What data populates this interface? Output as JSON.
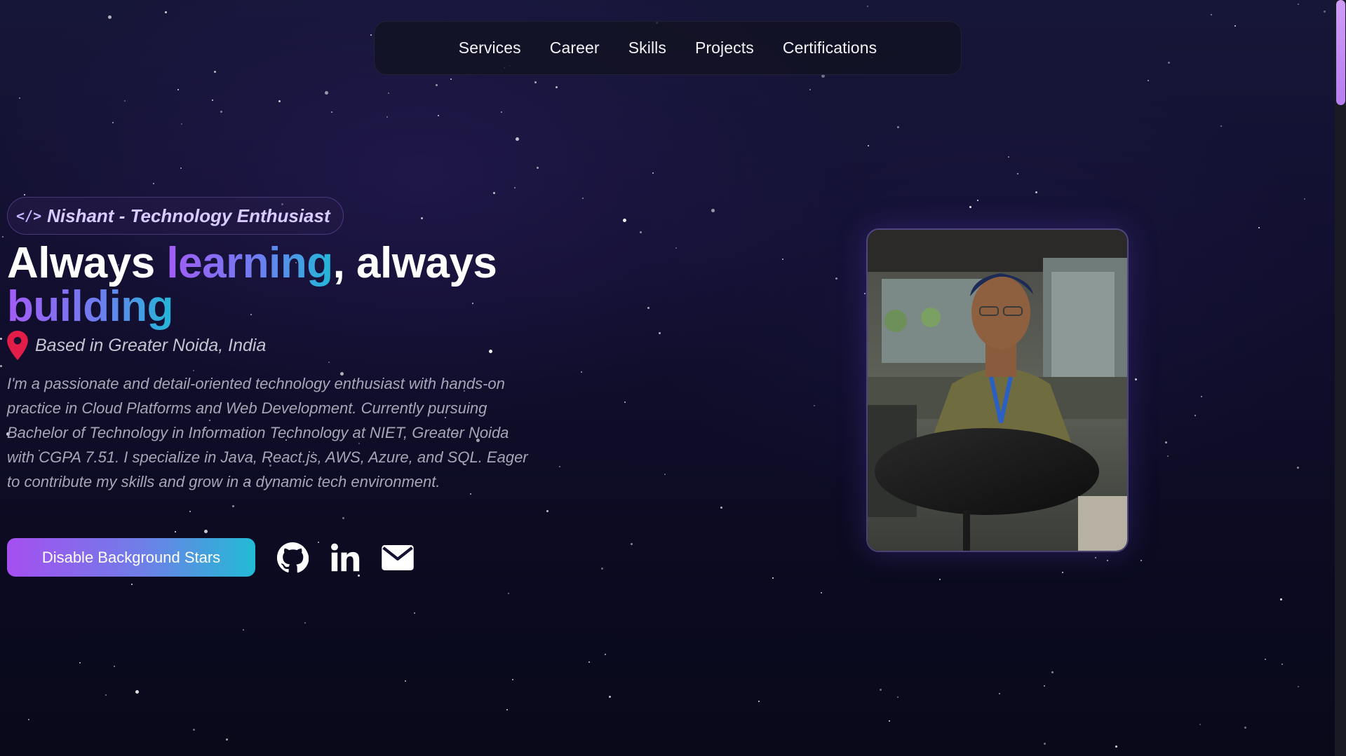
{
  "nav": {
    "items": [
      {
        "label": "Services"
      },
      {
        "label": "Career"
      },
      {
        "label": "Skills"
      },
      {
        "label": "Projects"
      },
      {
        "label": "Certifications"
      }
    ]
  },
  "hero": {
    "badge_icon": "code-icon",
    "badge_text": "Nishant - Technology Enthusiast",
    "headline": {
      "part1": "Always ",
      "highlight1": "learning",
      "part2": ", always ",
      "highlight2": "building"
    },
    "location_icon": "map-pin-icon",
    "location": "Based in Greater Noida, India",
    "bio": "I'm a passionate and detail-oriented technology enthusiast with hands-on practice in Cloud Platforms and Web Development. Currently pursuing Bachelor of Technology in Information Technology at NIET, Greater Noida with CGPA 7.51. I specialize in Java, React.js, AWS, Azure, and SQL. Eager to contribute my skills and grow in a dynamic tech environment.",
    "stars_button_label": "Disable Background Stars",
    "social_icons": [
      "github-icon",
      "linkedin-icon",
      "mail-icon"
    ]
  },
  "colors": {
    "accent_purple": "#a35cf5",
    "accent_cyan": "#22b8d8",
    "pin_red": "#e11d48",
    "background": "#120f30"
  }
}
